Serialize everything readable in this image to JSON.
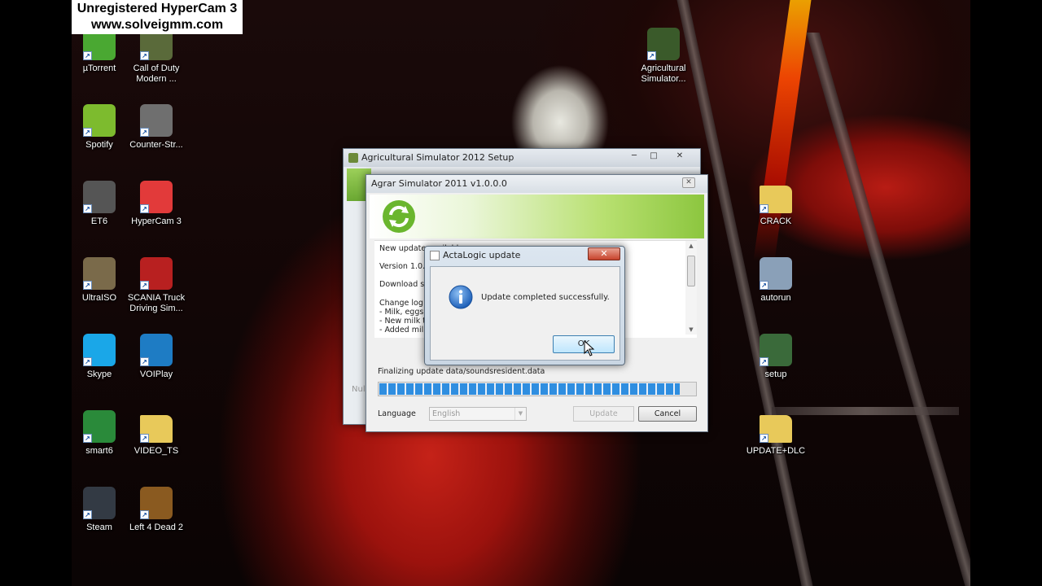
{
  "watermark": {
    "line1": "Unregistered HyperCam 3",
    "line2": "www.solveigmm.com"
  },
  "desktop_icons": [
    {
      "label": "µTorrent",
      "icon": "utorrent-icon",
      "color": "#4aa832"
    },
    {
      "label": "Call of Duty Modern ...",
      "icon": "call-of-duty-icon",
      "color": "#5a6a3a"
    },
    {
      "label": "Spotify",
      "icon": "spotify-icon",
      "color": "#7dbb2e"
    },
    {
      "label": "Counter-Str...",
      "icon": "counter-strike-icon",
      "color": "#6f6f6f"
    },
    {
      "label": "ET6",
      "icon": "et6-icon",
      "color": "#555555"
    },
    {
      "label": "HyperCam 3",
      "icon": "hypercam-icon",
      "color": "#e23a3a"
    },
    {
      "label": "UltraISO",
      "icon": "ultraiso-icon",
      "color": "#7a6a4a"
    },
    {
      "label": "SCANIA Truck Driving Sim...",
      "icon": "scania-truck-icon",
      "color": "#b82020"
    },
    {
      "label": "Skype",
      "icon": "skype-icon",
      "color": "#1aa7e8"
    },
    {
      "label": "VOIPlay",
      "icon": "voiplay-icon",
      "color": "#1e7cc4"
    },
    {
      "label": "smart6",
      "icon": "smart6-icon",
      "color": "#2a8a3a"
    },
    {
      "label": "VIDEO_TS",
      "icon": "folder-icon",
      "color": "#e8c95a"
    },
    {
      "label": "Steam",
      "icon": "steam-icon",
      "color": "#333a44"
    },
    {
      "label": "Left 4 Dead 2",
      "icon": "left4dead2-icon",
      "color": "#8a5a20"
    },
    {
      "label": "Agricultural Simulator...",
      "icon": "tractor-icon",
      "color": "#3a5a2a"
    },
    {
      "label": "CRACK",
      "icon": "folder-icon",
      "color": "#e8c95a"
    },
    {
      "label": "autorun",
      "icon": "autorun-icon",
      "color": "#8aa0b8"
    },
    {
      "label": "setup",
      "icon": "setup-icon",
      "color": "#3a6a3a"
    },
    {
      "label": "UPDATE+DLC",
      "icon": "folder-icon",
      "color": "#e8c95a"
    }
  ],
  "setup_window": {
    "title": "Agricultural Simulator 2012 Setup",
    "fragment": "Nul"
  },
  "updater": {
    "title": "Agrar Simulator 2011 v1.0.0.0",
    "info": {
      "new_update": "New update available",
      "version": "Version 1.0.1",
      "download_size": "Download size",
      "change_log": "Change log f",
      "log1": "- Milk, eggs a",
      "log2": "- New milk tra",
      "log3": "- Added milk f"
    },
    "status": "Finalizing update data/soundsresident.data",
    "progress": 0.95,
    "language_label": "Language",
    "language_value": "English",
    "update_button": "Update",
    "cancel_button": "Cancel"
  },
  "dialog": {
    "title": "ActaLogic update",
    "message": "Update completed successfully.",
    "ok_button": "OK"
  },
  "colors": {
    "progress": "#2f8ee0",
    "accent_green": "#8cc63f"
  }
}
